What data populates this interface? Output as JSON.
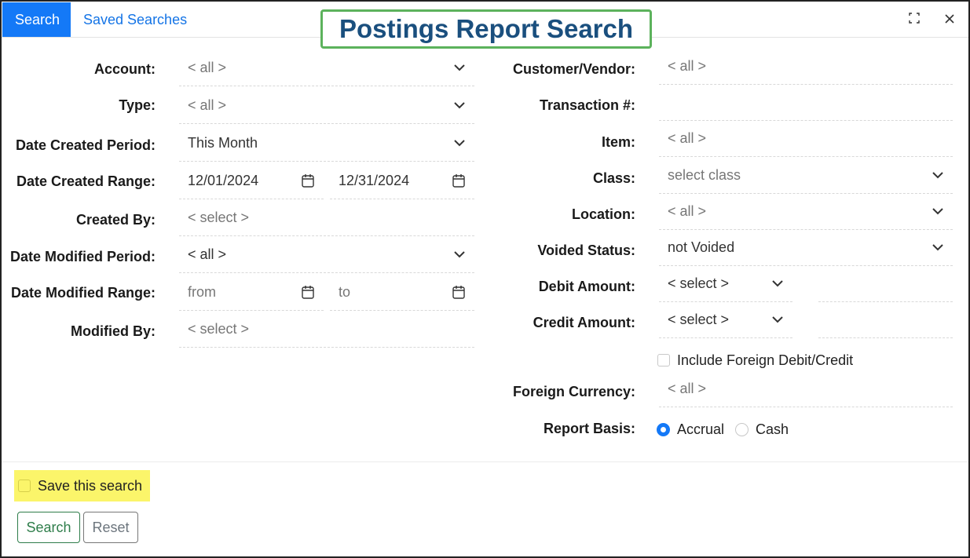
{
  "header": {
    "tab_search": "Search",
    "tab_saved": "Saved Searches",
    "title": "Postings Report Search"
  },
  "left": {
    "account": {
      "label": "Account:",
      "value": "< all >"
    },
    "type": {
      "label": "Type:",
      "value": "< all >"
    },
    "date_created_period": {
      "label": "Date Created Period:",
      "value": "This Month"
    },
    "date_created_range": {
      "label": "Date Created Range:",
      "from": "12/01/2024",
      "to": "12/31/2024"
    },
    "created_by": {
      "label": "Created By:",
      "value": "< select >"
    },
    "date_modified_period": {
      "label": "Date Modified Period:",
      "value": "< all >"
    },
    "date_modified_range": {
      "label": "Date Modified Range:",
      "from_placeholder": "from",
      "to_placeholder": "to"
    },
    "modified_by": {
      "label": "Modified By:",
      "value": "< select >"
    }
  },
  "right": {
    "customer_vendor": {
      "label": "Customer/Vendor:",
      "value": "< all >"
    },
    "transaction": {
      "label": "Transaction #:",
      "value": ""
    },
    "item": {
      "label": "Item:",
      "value": "< all >"
    },
    "class": {
      "label": "Class:",
      "placeholder": "select class"
    },
    "location": {
      "label": "Location:",
      "value": "< all >"
    },
    "voided_status": {
      "label": "Voided Status:",
      "value": "not Voided"
    },
    "debit_amount": {
      "label": "Debit Amount:",
      "value": "< select >"
    },
    "credit_amount": {
      "label": "Credit Amount:",
      "value": "< select >"
    },
    "include_foreign": {
      "label": "Include Foreign Debit/Credit",
      "checked": false
    },
    "foreign_currency": {
      "label": "Foreign Currency:",
      "value": "< all >"
    },
    "report_basis": {
      "label": "Report Basis:",
      "options": [
        "Accrual",
        "Cash"
      ],
      "selected": "Accrual"
    }
  },
  "footer": {
    "save_search": "Save this search",
    "search_button": "Search",
    "reset_button": "Reset"
  },
  "colors": {
    "accent": "#1479f7",
    "title": "#1a4f7e",
    "title_border": "#5cb25c",
    "highlight": "#fbf56a",
    "primary_btn": "#2e7d4a"
  }
}
